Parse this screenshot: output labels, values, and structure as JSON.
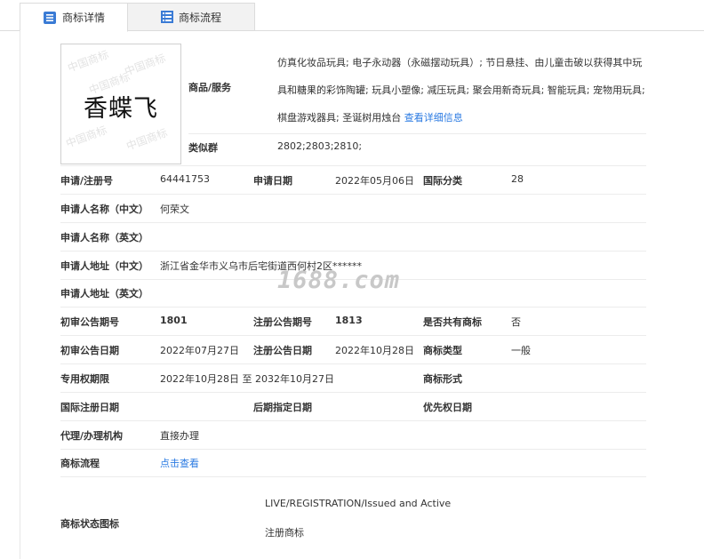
{
  "tabs": [
    {
      "label": "商标详情",
      "icon": "document-icon"
    },
    {
      "label": "商标流程",
      "icon": "list-icon"
    }
  ],
  "logo": {
    "text": "香蝶飞",
    "watermark": "中国商标"
  },
  "goods": {
    "label": "商品/服务",
    "text": "仿真化妆品玩具; 电子永动器（永磁摆动玩具）; 节日悬挂、由儿童击破以获得其中玩具和糖果的彩饰陶罐; 玩具小塑像; 减压玩具; 聚会用新奇玩具; 智能玩具; 宠物用玩具; 棋盘游戏器具; 圣诞树用烛台",
    "link": "查看详细信息"
  },
  "similar_group": {
    "label": "类似群",
    "value": "2802;2803;2810;"
  },
  "rows": {
    "reg_no": {
      "label": "申请/注册号",
      "value": "64441753"
    },
    "apply_date": {
      "label": "申请日期",
      "value": "2022年05月06日"
    },
    "intl_class": {
      "label": "国际分类",
      "value": "28"
    },
    "applicant_cn": {
      "label": "申请人名称（中文）",
      "value": "何荣文"
    },
    "applicant_en": {
      "label": "申请人名称（英文）",
      "value": ""
    },
    "address_cn": {
      "label": "申请人地址（中文）",
      "value": "浙江省金华市义乌市后宅街道西何村2区******"
    },
    "address_en": {
      "label": "申请人地址（英文）",
      "value": ""
    },
    "prelim_no": {
      "label": "初审公告期号",
      "value": "1801"
    },
    "reg_pub_no": {
      "label": "注册公告期号",
      "value": "1813"
    },
    "shared": {
      "label": "是否共有商标",
      "value": "否"
    },
    "prelim_date": {
      "label": "初审公告日期",
      "value": "2022年07月27日"
    },
    "reg_pub_date": {
      "label": "注册公告日期",
      "value": "2022年10月28日"
    },
    "mark_type": {
      "label": "商标类型",
      "value": "一般"
    },
    "exclusive": {
      "label": "专用权期限",
      "value": "2022年10月28日 至 2032年10月27日"
    },
    "mark_form": {
      "label": "商标形式",
      "value": ""
    },
    "intl_reg_date": {
      "label": "国际注册日期",
      "value": ""
    },
    "later_date": {
      "label": "后期指定日期",
      "value": ""
    },
    "priority_date": {
      "label": "优先权日期",
      "value": ""
    },
    "agent": {
      "label": "代理/办理机构",
      "value": "直接办理"
    },
    "process": {
      "label": "商标流程",
      "value": "点击查看"
    },
    "status": {
      "label": "商标状态图标",
      "value_en": "LIVE/REGISTRATION/Issued and Active",
      "value_cn": "注册商标"
    }
  },
  "watermark_site": "1688.com"
}
